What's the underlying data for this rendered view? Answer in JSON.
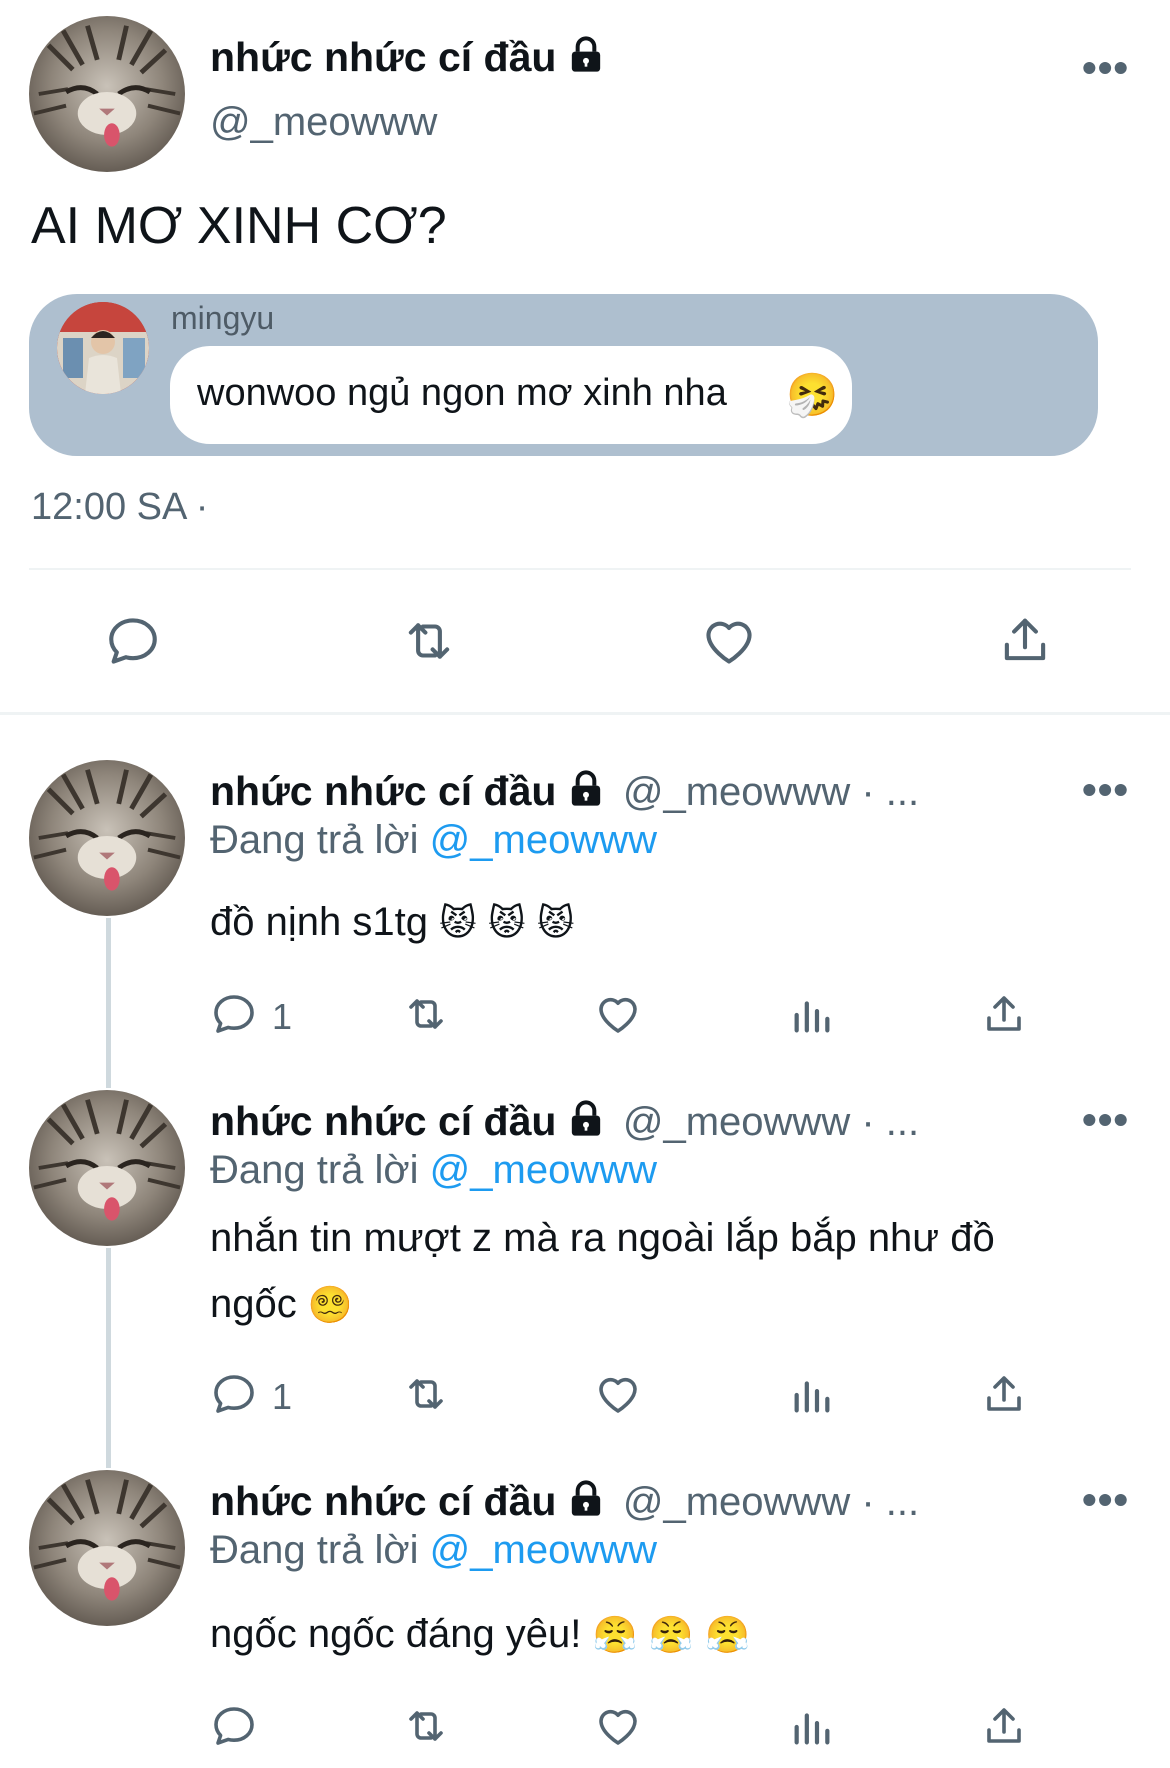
{
  "main_tweet": {
    "display_name": "nhức nhức cí đầu",
    "handle": "@_meowww",
    "text": "AI MƠ XINH CƠ?",
    "quoted_message": {
      "sender": "mingyu",
      "text": "wonwoo ngủ ngon mơ xinh nha",
      "emoji": "🤧"
    },
    "timestamp": "12:00 SA ·",
    "more_label": "•••"
  },
  "replies": [
    {
      "display_name": "nhức nhức cí đầu",
      "handle": "@_meowww · ...",
      "replying_prefix": "Đang trả lời",
      "replying_to": "@_meowww",
      "text": "đồ nịnh s1tg",
      "emojis": "😾 😾 😾",
      "reply_count": "1",
      "more_label": "•••"
    },
    {
      "display_name": "nhức nhức cí đầu",
      "handle": "@_meowww · ...",
      "replying_prefix": "Đang trả lời",
      "replying_to": "@_meowww",
      "text_line1": "nhắn tin mượt z mà ra ngoài lắp bắp như đồ",
      "text_line2": "ngốc",
      "emojis": "😵‍💫",
      "reply_count": "1",
      "more_label": "•••"
    },
    {
      "display_name": "nhức nhức cí đầu",
      "handle": "@_meowww · ...",
      "replying_prefix": "Đang trả lời",
      "replying_to": "@_meowww",
      "text": "ngốc ngốc đáng yêu!",
      "emojis": "😤 😤 😤",
      "more_label": "•••"
    }
  ],
  "colors": {
    "text": "#0f1419",
    "secondary": "#536471",
    "link": "#1d9bf0",
    "quote_bg": "#aebfcf",
    "divider": "#eff3f4"
  },
  "icons": [
    "comment-icon",
    "retweet-icon",
    "like-icon",
    "share-icon",
    "views-icon",
    "lock-icon",
    "more-icon"
  ]
}
